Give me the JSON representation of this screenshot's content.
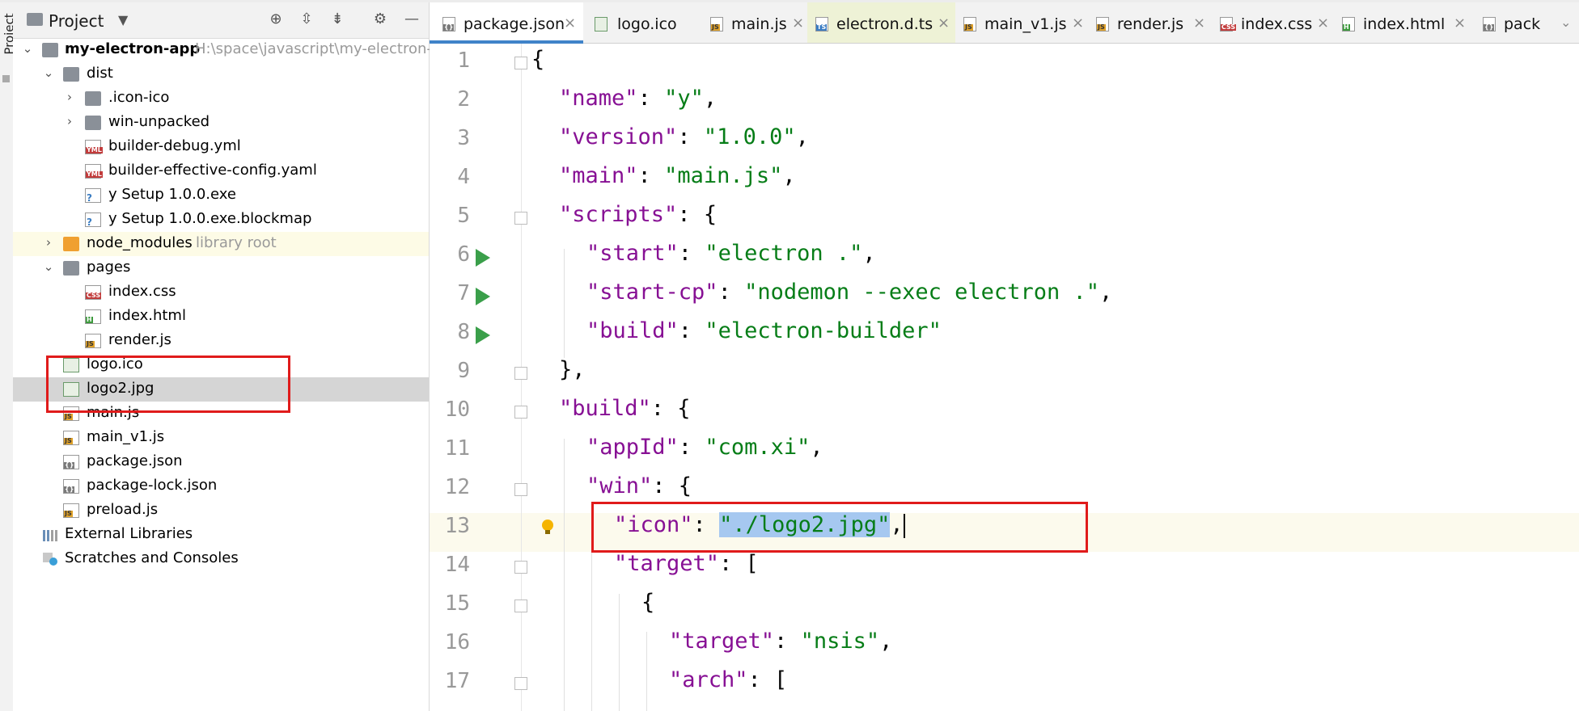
{
  "project_panel": {
    "title": "Project",
    "tree": [
      {
        "name": "my-electron-app",
        "hint": "H:\\space\\javascript\\my-electron-a"
      },
      {
        "name": "dist"
      },
      {
        "name": ".icon-ico"
      },
      {
        "name": "win-unpacked"
      },
      {
        "name": "builder-debug.yml",
        "type": "YML"
      },
      {
        "name": "builder-effective-config.yaml",
        "type": "YML"
      },
      {
        "name": "y Setup 1.0.0.exe"
      },
      {
        "name": "y Setup 1.0.0.exe.blockmap"
      },
      {
        "name": "node_modules",
        "hint": "library root"
      },
      {
        "name": "pages"
      },
      {
        "name": "index.css",
        "type": "CSS"
      },
      {
        "name": "index.html",
        "type": "H"
      },
      {
        "name": "render.js",
        "type": "JS"
      },
      {
        "name": "logo.ico"
      },
      {
        "name": "logo2.jpg"
      },
      {
        "name": "main.js",
        "type": "JS"
      },
      {
        "name": "main_v1.js",
        "type": "JS"
      },
      {
        "name": "package.json",
        "type": "{}"
      },
      {
        "name": "package-lock.json",
        "type": "{}"
      },
      {
        "name": "preload.js",
        "type": "JS"
      },
      {
        "name": "External Libraries"
      },
      {
        "name": "Scratches and Consoles"
      }
    ],
    "stripe_label": "Project"
  },
  "tabs": [
    {
      "label": "package.json",
      "icon": "json-file-icon"
    },
    {
      "label": "logo.ico",
      "icon": "image-file-icon"
    },
    {
      "label": "main.js",
      "icon": "js-file-icon"
    },
    {
      "label": "electron.d.ts",
      "icon": "ts-file-icon"
    },
    {
      "label": "main_v1.js",
      "icon": "js-file-icon"
    },
    {
      "label": "render.js",
      "icon": "js-file-icon"
    },
    {
      "label": "index.css",
      "icon": "css-file-icon"
    },
    {
      "label": "index.html",
      "icon": "html-file-icon"
    },
    {
      "label": "pack",
      "icon": "json-file-icon"
    }
  ],
  "editor": {
    "line_numbers": [
      "1",
      "2",
      "3",
      "4",
      "5",
      "6",
      "7",
      "8",
      "9",
      "10",
      "11",
      "12",
      "13",
      "14",
      "15",
      "16",
      "17"
    ],
    "lines": [
      [
        [
          "p",
          "{"
        ]
      ],
      [
        [
          "k",
          "\"name\""
        ],
        [
          "p",
          ": "
        ],
        [
          "s",
          "\"y\""
        ],
        [
          "p",
          ","
        ]
      ],
      [
        [
          "k",
          "\"version\""
        ],
        [
          "p",
          ": "
        ],
        [
          "s",
          "\"1.0.0\""
        ],
        [
          "p",
          ","
        ]
      ],
      [
        [
          "k",
          "\"main\""
        ],
        [
          "p",
          ": "
        ],
        [
          "s",
          "\"main.js\""
        ],
        [
          "p",
          ","
        ]
      ],
      [
        [
          "k",
          "\"scripts\""
        ],
        [
          "p",
          ": {"
        ]
      ],
      [
        [
          "k",
          "\"start\""
        ],
        [
          "p",
          ": "
        ],
        [
          "s",
          "\"electron .\""
        ],
        [
          "p",
          ","
        ]
      ],
      [
        [
          "k",
          "\"start-cp\""
        ],
        [
          "p",
          ": "
        ],
        [
          "s",
          "\"nodemon --exec electron .\""
        ],
        [
          "p",
          ","
        ]
      ],
      [
        [
          "k",
          "\"build\""
        ],
        [
          "p",
          ": "
        ],
        [
          "s",
          "\"electron-builder\""
        ]
      ],
      [
        [
          "p",
          "},"
        ]
      ],
      [
        [
          "k",
          "\"build\""
        ],
        [
          "p",
          ": {"
        ]
      ],
      [
        [
          "k",
          "\"appId\""
        ],
        [
          "p",
          ": "
        ],
        [
          "s",
          "\"com.xi\""
        ],
        [
          "p",
          ","
        ]
      ],
      [
        [
          "k",
          "\"win\""
        ],
        [
          "p",
          ": {"
        ]
      ],
      [
        [
          "k",
          "\"icon\""
        ],
        [
          "p",
          ": "
        ],
        [
          "sel",
          "\"./logo2.jpg\""
        ],
        [
          "p",
          ","
        ]
      ],
      [
        [
          "k",
          "\"target\""
        ],
        [
          "p",
          ": ["
        ]
      ],
      [
        [
          "p",
          "{"
        ]
      ],
      [
        [
          "k",
          "\"target\""
        ],
        [
          "p",
          ": "
        ],
        [
          "s",
          "\"nsis\""
        ],
        [
          "p",
          ","
        ]
      ],
      [
        [
          "k",
          "\"arch\""
        ],
        [
          "p",
          ": ["
        ]
      ]
    ]
  },
  "colors": {
    "key": "#871094",
    "string": "#067d17",
    "selection": "#a6c8f0",
    "highlight_box": "#e01b1b",
    "active_tab_underline": "#4083c9"
  }
}
